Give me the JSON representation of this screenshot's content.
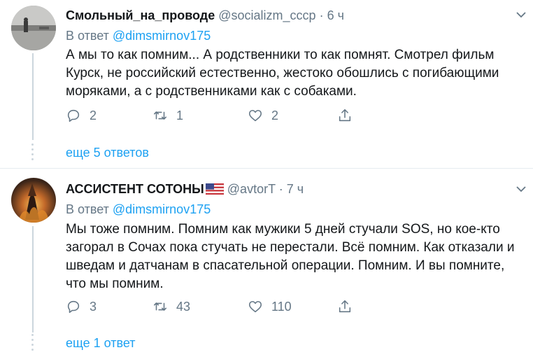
{
  "tweets": [
    {
      "name": "Смольный_на_проводе",
      "handle": "@socializm_cccp",
      "dot": "·",
      "time": "6 ч",
      "reply_prefix": "В ответ",
      "reply_mention": "@dimsmirnov175",
      "text": "А мы то как помним... А родственники то как помнят. Смотрел фильм Курск, не российский естественно, жестоко обошлись с погибающими моряками, а с родственниками как с собаками.",
      "counts": {
        "reply": "2",
        "retweet": "1",
        "like": "2"
      },
      "more_replies": "еще 5 ответов"
    },
    {
      "name": "АССИСТЕНТ СОТОНЫ",
      "handle": "@avtorT",
      "dot": "·",
      "time": "7 ч",
      "reply_prefix": "В ответ",
      "reply_mention": "@dimsmirnov175",
      "text": "Мы тоже помним. Помним как мужики 5 дней стучали SOS, но кое-кто загорал в Сочах пока стучать не перестали. Всё помним. Как отказали и шведам и датчанам в спасательной операции. Помним. И вы помните, что мы помним.",
      "counts": {
        "reply": "3",
        "retweet": "43",
        "like": "110"
      },
      "more_replies": "еще 1 ответ"
    }
  ],
  "icons": {
    "reply": "reply-icon",
    "retweet": "retweet-icon",
    "like": "heart-icon",
    "share": "share-icon",
    "caret": "chevron-down-icon",
    "flag": "us-flag-icon"
  },
  "colors": {
    "link": "#1da1f2",
    "secondary": "#657786",
    "text": "#14171a",
    "divider": "#e6ecf0"
  }
}
